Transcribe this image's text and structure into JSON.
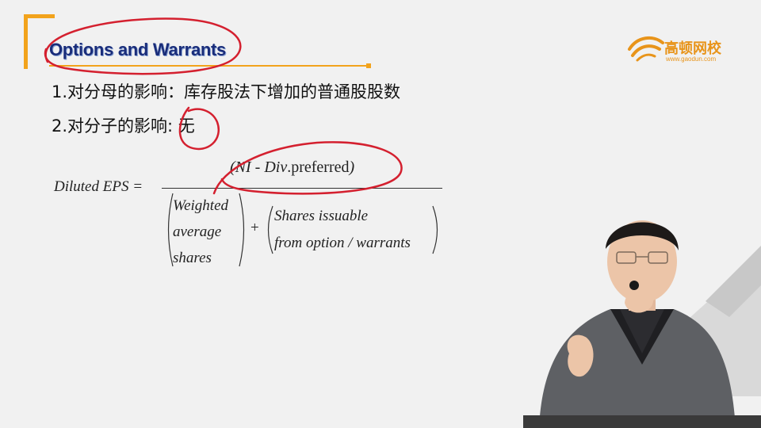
{
  "slide": {
    "title": "Options and Warrants",
    "points": [
      "1.对分母的影响：库存股法下增加的普通股股数",
      "2.对分子的影响: 无"
    ]
  },
  "logo": {
    "name": "高顿网校",
    "url": "www.gaodun.com"
  },
  "formula": {
    "lhs": "Diluted EPS =",
    "numerator_open": "(",
    "numerator_italic": "NI - Div",
    "numerator_upright": ".preferred",
    "numerator_close": ")",
    "denominator_term1": [
      "Weighted",
      "average",
      "shares"
    ],
    "plus": "+",
    "denominator_term2": [
      "Shares issuable",
      "from option / warrants"
    ]
  },
  "colors": {
    "accent": "#f2a31c",
    "title": "#1a2d7a",
    "annotation": "#d4202f"
  }
}
